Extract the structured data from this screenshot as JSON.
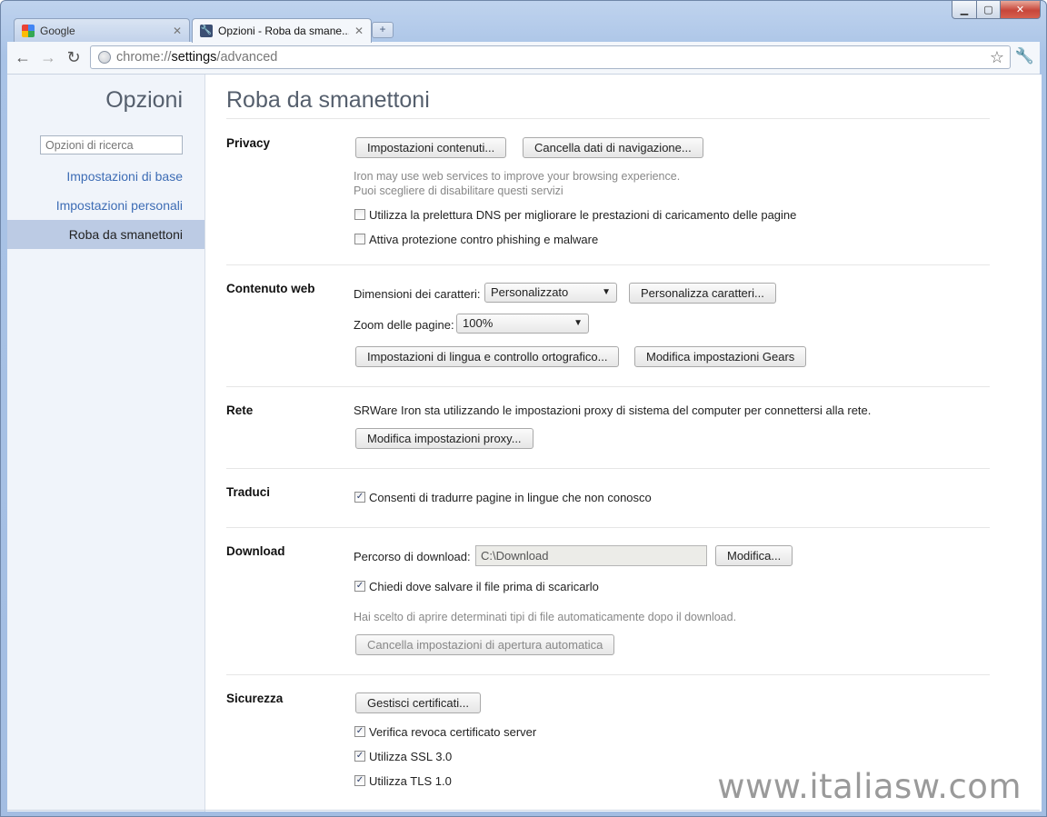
{
  "window": {
    "controls": {
      "minimize": "▁",
      "maximize": "▢",
      "close": "✕"
    }
  },
  "tabs": [
    {
      "title": "Google",
      "icon": "google-favicon",
      "active": false
    },
    {
      "title": "Opzioni - Roba da smane...",
      "icon": "wrench-icon",
      "active": true
    }
  ],
  "newtab_glyph": "+",
  "omnibox": {
    "scheme": "chrome://",
    "host": "settings",
    "path": "/advanced"
  },
  "sidebar": {
    "title": "Opzioni",
    "search_placeholder": "Opzioni di ricerca",
    "items": [
      {
        "label": "Impostazioni di base",
        "selected": false
      },
      {
        "label": "Impostazioni personali",
        "selected": false
      },
      {
        "label": "Roba da smanettoni",
        "selected": true
      }
    ]
  },
  "main": {
    "title": "Roba da smanettoni",
    "privacy": {
      "title": "Privacy",
      "btn_content": "Impostazioni contenuti...",
      "btn_clear": "Cancella dati di navigazione...",
      "note_line1": "Iron may use web services to improve your browsing experience.",
      "note_line2": "Puoi scegliere di disabilitare questi servizi",
      "cb_dns": {
        "label": "Utilizza la prelettura DNS per migliorare le prestazioni di caricamento delle pagine",
        "checked": false
      },
      "cb_phishing": {
        "label": "Attiva protezione contro phishing e malware",
        "checked": false
      }
    },
    "web": {
      "title": "Contenuto web",
      "font_size_label": "Dimensioni dei caratteri:",
      "font_size_value": "Personalizzato",
      "btn_fonts": "Personalizza caratteri...",
      "zoom_label": "Zoom delle pagine:",
      "zoom_value": "100%",
      "btn_lang": "Impostazioni di lingua e controllo ortografico...",
      "btn_gears": "Modifica impostazioni Gears"
    },
    "network": {
      "title": "Rete",
      "text": "SRWare Iron sta utilizzando le impostazioni proxy di sistema del computer per connettersi alla rete.",
      "btn_proxy": "Modifica impostazioni proxy..."
    },
    "translate": {
      "title": "Traduci",
      "cb_translate": {
        "label": "Consenti di tradurre pagine in lingue che non conosco",
        "checked": true
      }
    },
    "download": {
      "title": "Download",
      "path_label": "Percorso di download:",
      "path_value": "C:\\Download",
      "btn_change": "Modifica...",
      "cb_ask": {
        "label": "Chiedi dove salvare il file prima di scaricarlo",
        "checked": true
      },
      "note": "Hai scelto di aprire determinati tipi di file automaticamente dopo il download.",
      "btn_reset_auto": "Cancella impostazioni di apertura automatica"
    },
    "security": {
      "title": "Sicurezza",
      "btn_certs": "Gestisci certificati...",
      "cb_revoke": {
        "label": "Verifica revoca certificato server",
        "checked": true
      },
      "cb_ssl": {
        "label": "Utilizza SSL 3.0",
        "checked": true
      },
      "cb_tls": {
        "label": "Utilizza TLS 1.0",
        "checked": true
      }
    }
  },
  "watermark": "www.italiasw.com",
  "check_glyph": "✓"
}
